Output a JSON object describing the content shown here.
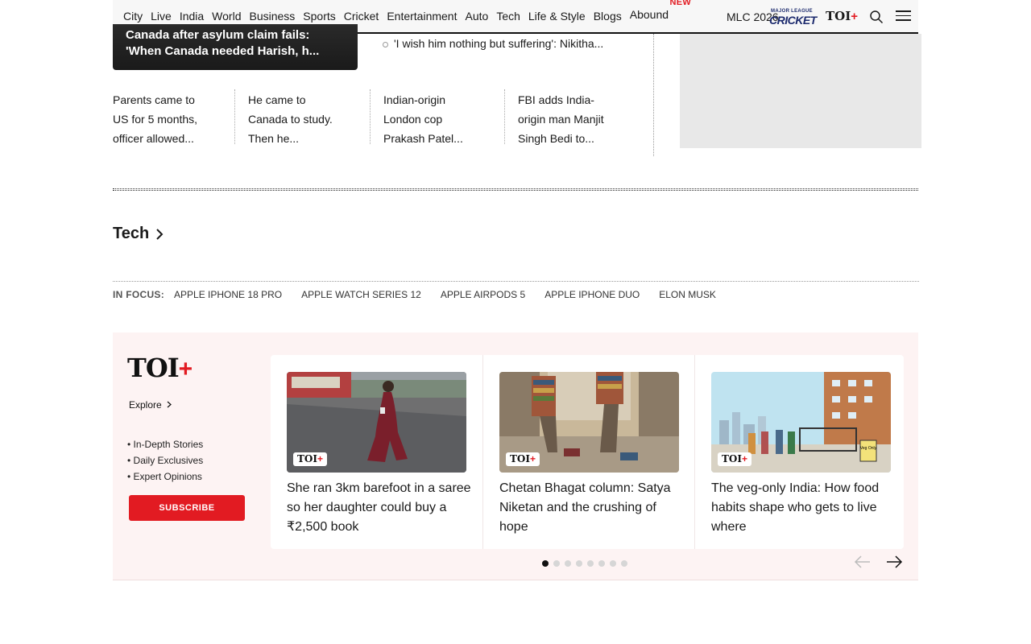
{
  "nav": {
    "items": [
      "City",
      "Live",
      "India",
      "World",
      "Business",
      "Sports",
      "Cricket",
      "Entertainment",
      "Auto",
      "Tech",
      "Life & Style",
      "Blogs",
      "Abound"
    ],
    "new_badge": "NEW",
    "mlc": "MLC 2026",
    "mlc_logo_top": "MAJOR LEAGUE",
    "mlc_logo_bottom": "CRICKET",
    "toi": "TOI",
    "plus": "+"
  },
  "lead": {
    "headline": "Canada after asylum claim fails: 'When Canada needed Harish, h...",
    "bullet": "'I wish him nothing but suffering': Nikitha..."
  },
  "mini_stories": [
    "Parents came to US for 5 months, officer allowed...",
    "He came to Canada to study. Then he...",
    "Indian-origin London cop Prakash Patel...",
    "FBI adds India-origin man Manjit Singh Bedi to..."
  ],
  "section": {
    "title": "Tech"
  },
  "in_focus": {
    "label": "IN FOCUS:",
    "topics": [
      "APPLE IPHONE 18 PRO",
      "APPLE WATCH SERIES 12",
      "APPLE AIRPODS 5",
      "APPLE IPHONE DUO",
      "ELON MUSK"
    ]
  },
  "promo": {
    "logo": "TOI",
    "plus": "+",
    "explore": "Explore",
    "features": [
      "• In-Depth Stories",
      "• Daily Exclusives",
      "• Expert Opinions"
    ],
    "subscribe": "SUBSCRIBE",
    "cards": [
      {
        "title": "She ran 3km barefoot in a saree so her daughter could buy a ₹2,500 book",
        "tag": "TOI"
      },
      {
        "title": "Chetan Bhagat column: Satya Niketan and the crushing of hope",
        "tag": "TOI"
      },
      {
        "title": "The veg-only India: How food habits shape who gets to live where",
        "tag": "TOI"
      }
    ],
    "sign_text": "Veg Only",
    "carousel_count": 8,
    "active_index": 0
  },
  "colors": {
    "accent": "#e21b22",
    "promo_bg": "#fdf3f3",
    "ad_bg": "#e8e8e8"
  }
}
